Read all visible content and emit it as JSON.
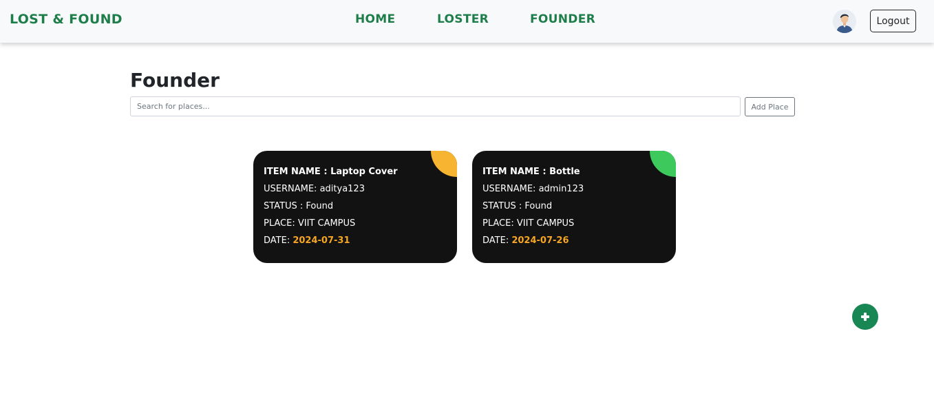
{
  "navbar": {
    "brand": "LOST & FOUND",
    "links": [
      "HOME",
      "LOSTER",
      "FOUNDER"
    ],
    "logout_label": "Logout",
    "accent": "#1e7e4a"
  },
  "main": {
    "title": "Founder",
    "search_placeholder": "Search for places...",
    "add_place_label": "Add Place"
  },
  "cards": [
    {
      "item_label": "ITEM NAME : ",
      "item_name": "Laptop Cover",
      "username_label": "USERNAME: ",
      "username": "aditya123",
      "status_label": "STATUS : ",
      "status": "Found",
      "place_label": "PLACE: ",
      "place": "VIIT CAMPUS",
      "date_label": "DATE: ",
      "date": "2024-07-31",
      "corner_color": "#f7b430"
    },
    {
      "item_label": "ITEM NAME : ",
      "item_name": "Bottle",
      "username_label": "USERNAME: ",
      "username": "admin123",
      "status_label": "STATUS : ",
      "status": "Found",
      "place_label": "PLACE: ",
      "place": "VIIT CAMPUS",
      "date_label": "DATE: ",
      "date": "2024-07-26",
      "corner_color": "#3ec95c"
    }
  ],
  "fab": {
    "icon": "plus-icon",
    "color": "#198754"
  }
}
